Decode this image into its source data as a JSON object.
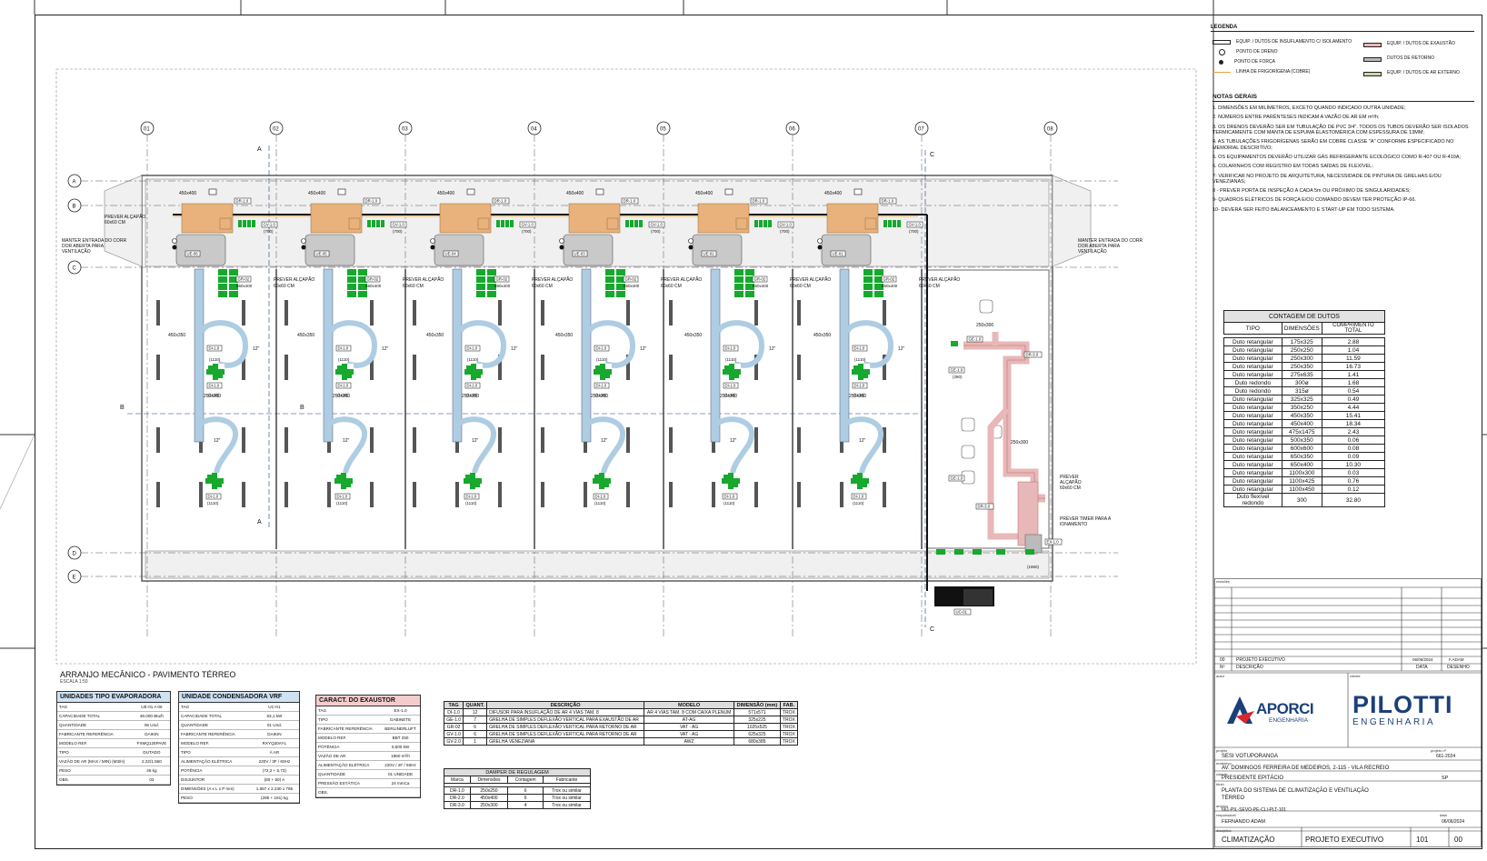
{
  "drawing": {
    "title": "ARRANJO MECÂNICO  -  PAVIMENTO TÉRREO",
    "scale": "ESCALA 1:50",
    "grid_cols": [
      "01",
      "02",
      "03",
      "04",
      "05",
      "06",
      "07",
      "08"
    ],
    "grid_rows": [
      "A",
      "B",
      "C",
      "D",
      "E"
    ],
    "section_marks": [
      "A",
      "B",
      "C"
    ],
    "evaporators": [
      "UE-06",
      "UE-05",
      "UE-04",
      "UE-03",
      "UE-02",
      "UE-01"
    ],
    "condenser_tag": "UC-01",
    "labels": {
      "prever_alcapao": "PREVER ALÇAPÃO",
      "alcapao_size": "60x60 CM",
      "manter_entrada": "MANTER ENTRADA DO CORREDOR ABERTA PARA VENTILAÇÃO",
      "prever_timer": "PREVER TIMER PARA ACIONAMENTO",
      "di_tag": "DI-1.0",
      "di_flow": "(1110)",
      "gr_tag": "GR-02",
      "gr_dim": "650x400",
      "duct_450x400": "450x400",
      "duct_450x350": "450x350",
      "duct_250x350": "250x350",
      "flex": "12\"",
      "dr_tag": "DR-1.0",
      "gv_tag": "GV-1.0",
      "gv_flow": "(700)",
      "ge_tag": "GE-1.0",
      "ge_flow": "(280)",
      "ext_250x300": "250x300",
      "dr3": "DR-3.0",
      "ex_tag": "EX-1.0",
      "ex_flow": "(1960)"
    }
  },
  "legend": {
    "title": "LEGENDA",
    "items_left": [
      "EQUIP. / DUTOS DE INSUFLAMENTO C/ ISOLAMENTO",
      "PONTO DE DRENO",
      "PONTO DE FORÇA",
      "LINHA DE FRIGORÍGENA (COBRE)"
    ],
    "items_right": [
      "EQUIP. / DUTOS DE EXAUSTÃO",
      "DUTOS DE RETORNO",
      "EQUIP. / DUTOS DE AR EXTERNO"
    ],
    "colors": {
      "supply": "#aecde3",
      "exhaust": "#e8b7b7",
      "return": "#b9b9b9",
      "outside": "#c8d8a8",
      "refrigerant": "#e8a040",
      "device_green": "#17a82e",
      "box_orange": "#e9b27c"
    }
  },
  "notes": {
    "title": "NOTAS GERAIS",
    "items": [
      "1. DIMENSÕES EM MILÍMETROS, EXCETO QUANDO INDICADO OUTRA UNIDADE;",
      "2. NÚMEROS ENTRE PARÊNTESES INDICAM A VAZÃO DE AR EM m³/h;",
      "3. OS DRENOS DEVERÃO SER EM TUBULAÇÃO DE PVC 3/4\". TODOS OS TUBOS DEVERÃO SER ISOLADOS TERMICAMENTE COM MANTA DE ESPUMA ELASTOMÉRICA COM ESPESSURA DE 13MM;",
      "4. AS TUBULAÇÕES FRIGORÍGENAS SERÃO EM COBRE CLASSE \"A\" CONFORME ESPECIFICADO NO MEMORIAL DESCRITIVO;",
      "5. OS EQUIPAMENTOS DEVERÃO UTILIZAR GÁS REFRIGERANTE ECOLÓGICO COMO R-407 OU R-410A;",
      "6. COLARINHOS COM REGISTRO EM TODAS SAÍDAS DE FLEXÍVEL;",
      "7- VERIFICAR NO PROJETO DE ARQUITETURA, NECESSIDADE DE PINTURA DE GRELHAS E/OU VENEZIANAS;",
      "8 - PREVER PORTA DE INSPEÇÃO A CADA 5m OU PRÓXIMO DE SINGULARIDADES;",
      "9- QUADROS ELÉTRICOS DE FORÇA E/OU COMANDO DEVEM TER PROTEÇÃO IP-66.",
      "10- DEVERÁ SER FEITO BALANCEAMENTO E START-UP EM TODO SISTEMA."
    ]
  },
  "duct_count": {
    "title": "CONTAGEM DE DUTOS",
    "headers": [
      "TIPO",
      "DIMENSÕES",
      "COMPRIMENTO TOTAL"
    ],
    "rows": [
      [
        "Duto retangular",
        "175x325",
        "2.88"
      ],
      [
        "Duto retangular",
        "250x250",
        "1.04"
      ],
      [
        "Duto retangular",
        "250x300",
        "11.59"
      ],
      [
        "Duto retangular",
        "250x350",
        "16.73"
      ],
      [
        "Duto retangular",
        "275x635",
        "1.41"
      ],
      [
        "Duto redondo",
        "300ø",
        "1.68"
      ],
      [
        "Duto redondo",
        "315ø",
        "0.54"
      ],
      [
        "Duto retangular",
        "325x325",
        "0.49"
      ],
      [
        "Duto retangular",
        "350x250",
        "4.44"
      ],
      [
        "Duto retangular",
        "450x350",
        "15.41"
      ],
      [
        "Duto retangular",
        "450x400",
        "18.34"
      ],
      [
        "Duto retangular",
        "475x1475",
        "2.43"
      ],
      [
        "Duto retangular",
        "500x350",
        "0.06"
      ],
      [
        "Duto retangular",
        "600x600",
        "0.08"
      ],
      [
        "Duto retangular",
        "650x350",
        "0.09"
      ],
      [
        "Duto retangular",
        "650x400",
        "10.30"
      ],
      [
        "Duto retangular",
        "1100x300",
        "0.03"
      ],
      [
        "Duto retangular",
        "1100x425",
        "0.76"
      ],
      [
        "Duto retangular",
        "1100x450",
        "0.12"
      ],
      [
        "Duto flexível redondo",
        "300",
        "32.80"
      ]
    ]
  },
  "evap_spec": {
    "title": "UNIDADES TIPO EVAPORADORA",
    "rows": [
      [
        "TAG",
        "UE-01 A 06"
      ],
      [
        "CAPACIDADE TOTAL",
        "48.000 Btu/h"
      ],
      [
        "QUANTIDADE",
        "06 Und."
      ],
      [
        "FABRICANTE REFERÊNCIA",
        "DAIKIN"
      ],
      [
        "MODELO REF.",
        "FXMQ125PAVE"
      ],
      [
        "TIPO",
        "DUTADO"
      ],
      [
        "VAZÃO DE AR (MAX / MIN) (M3/H)",
        "2.22/1.560"
      ],
      [
        "PESO",
        "46 kg"
      ],
      [
        "OBS.",
        "03"
      ]
    ]
  },
  "cond_spec": {
    "title": "UNIDADE CONDENSADORA VRF",
    "rows": [
      [
        "TAG",
        "UC-01"
      ],
      [
        "CAPACIDADE TOTAL",
        "63,1 kW"
      ],
      [
        "QUANTIDADE",
        "01 Und."
      ],
      [
        "FABRICANTE REFERÊNCIA",
        "DAIKIN"
      ],
      [
        "MODELO REF.",
        "RXYQ20AYL"
      ],
      [
        "TIPO",
        "À AR"
      ],
      [
        "ALIMENTAÇÃO ELÉTRICA",
        "220V / 3F / 60Hz"
      ],
      [
        "POTÊNCIA",
        "(72,2 + 5,73)"
      ],
      [
        "DISJUNTOR",
        "(80 + 50) A"
      ],
      [
        "DIMENSÕES (A x L x P mm)",
        "1.657 x 2.230 x 765"
      ],
      [
        "PESO",
        "(285 + 191) kg"
      ]
    ]
  },
  "exh_spec": {
    "title": "CARACT. DO EXAUSTOR",
    "rows": [
      [
        "TAG",
        "EX-1.0"
      ],
      [
        "TIPO",
        "GABINETE"
      ],
      [
        "FABRICANTE REFERÊNCIA",
        "BERLINERLUFT"
      ],
      [
        "MODELO REF.",
        "BBT 250"
      ],
      [
        "POTÊNCIA",
        "0,500 kW"
      ],
      [
        "VAZÃO DE AR",
        "1960 m³/h"
      ],
      [
        "ALIMENTAÇÃO ELÉTRICA",
        "220V / 2F / 60Hz"
      ],
      [
        "QUANTIDADE",
        "01 UNIDADE"
      ],
      [
        "PRESSÃO ESTÁTICA",
        "24 mmCa"
      ],
      [
        "OBS.",
        ""
      ]
    ]
  },
  "devices": {
    "headers": [
      "TAG",
      "QUANT.",
      "DESCRIÇÃO",
      "MODELO",
      "DIMENSÃO (mm)",
      "FAB."
    ],
    "rows": [
      [
        "DI-1.0",
        "12",
        "DIFUSOR PARA INSUFLAÇÃO DE AR 4 VIAS TAM. 8",
        "AR 4 VIAS TAM. 8 COM CAIXA PLENUM",
        "571x571",
        "TROX"
      ],
      [
        "GE-1.0",
        "7",
        "GRELHA DE SIMPLES DEFLEXÃO VERTICAL PARA EXAUSTÃO DE AR",
        "AT-AG",
        "325x225",
        "TROX"
      ],
      [
        "GR-02",
        "6",
        "GRELHA DE SIMPLES DEFLEXÃO VERTICAL PARA RETORNO DE AR",
        "VAT - AG",
        "1025x525",
        "TROX"
      ],
      [
        "GV-1.0",
        "6",
        "GRELHA DE SIMPLES DEFLEXÃO VERTICAL PARA RETORNO DE AR",
        "VAT - AG",
        "625x325",
        "TROX"
      ],
      [
        "GV-2.0",
        "1",
        "GRELHA VENEZIANA",
        "AWZ",
        "680x385",
        "TROX"
      ]
    ]
  },
  "dampers": {
    "title": "DAMPER DE REGULAGEM",
    "headers": [
      "Marca",
      "Dimensões",
      "Contagem",
      "Fabricante"
    ],
    "rows": [
      [
        "DR-1.0",
        "250x250",
        "6",
        "Trox ou similar"
      ],
      [
        "DR-2.0",
        "450x400",
        "6",
        "Trox ou similar"
      ],
      [
        "DR-3.0",
        "250x300",
        "4",
        "Trox ou similar"
      ]
    ]
  },
  "titleblock": {
    "rev_rows": [
      [
        "00",
        "PROJETO EXECUTIVO",
        "06/06/2024",
        "F.ADAM"
      ]
    ],
    "rev_headers": [
      "Nº",
      "DESCRIÇÃO",
      "DATA",
      "DESENHO"
    ],
    "logo1_name": "APORCI",
    "logo1_sub": "ENGENHARIA",
    "logo2_name": "PILOTTI",
    "logo2_sub": "ENGENHARIA",
    "projeto": "SESI VOTUPORANGA",
    "projeto_num": "661-2024",
    "endereco": "AV. DOMINGOS FERREIRA DE MEDEIROS, 2-115 - VILA RECREIO",
    "cidade": "PRESIDENTE EPITÁCIO",
    "uf": "SP",
    "titulo1": "PLANTA DO SISTEMA DE CLIMATIZAÇÃO E VENTILAÇÃO",
    "titulo2": "TÉRREO",
    "arquivo": "661-PIL-SEVO-PE-CLI-PLT-101",
    "responsavel": "FERNANDO ADAM",
    "data": "06/06/2024",
    "disciplina": "CLIMATIZAÇÃO",
    "fase": "PROJETO EXECUTIVO",
    "folha": "101",
    "rev": "00"
  }
}
